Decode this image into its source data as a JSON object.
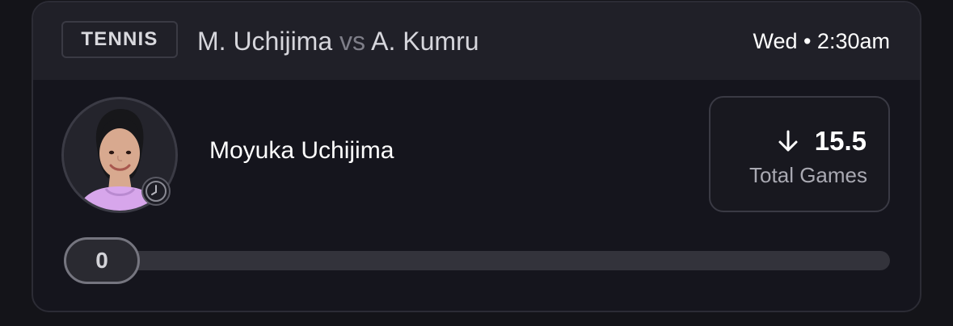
{
  "header": {
    "sport": "TENNIS",
    "player_one": "M. Uchijima",
    "vs": "vs",
    "player_two": "A. Kumru",
    "time": "Wed • 2:30am"
  },
  "player": {
    "name": "Moyuka Uchijima",
    "avatar_icon": "player-avatar",
    "status_icon": "clock-icon"
  },
  "stat": {
    "direction_icon": "arrow-down-icon",
    "value": "15.5",
    "label": "Total Games"
  },
  "progress": {
    "current": "0",
    "fraction": 0
  },
  "colors": {
    "background": "#141419",
    "header": "#202028",
    "accent": "#ffffff",
    "muted": "#7e7e88"
  }
}
